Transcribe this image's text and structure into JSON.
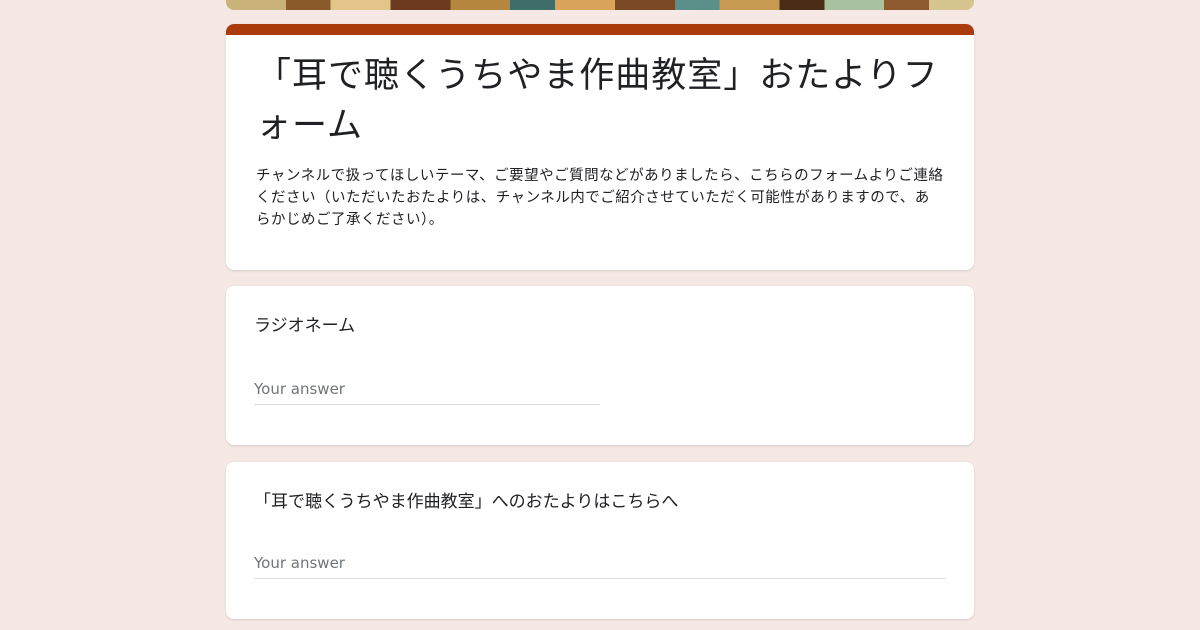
{
  "form": {
    "title": "「耳で聴くうちやま作曲教室」おたよりフォーム",
    "description": "チャンネルで扱ってほしいテーマ、ご要望やご質問などがありましたら、こちらのフォームよりご連絡ください（いただいたおたよりは、チャンネル内でご紹介させていただく可能性がありますので、あらかじめご了承ください）。",
    "accent_color": "#a93b0c",
    "background_color": "#f6e9e5"
  },
  "questions": [
    {
      "label": "ラジオネーム",
      "placeholder": "Your answer"
    },
    {
      "label": "「耳で聴くうちやま作曲教室」へのおたよりはこちらへ",
      "placeholder": "Your answer"
    }
  ]
}
